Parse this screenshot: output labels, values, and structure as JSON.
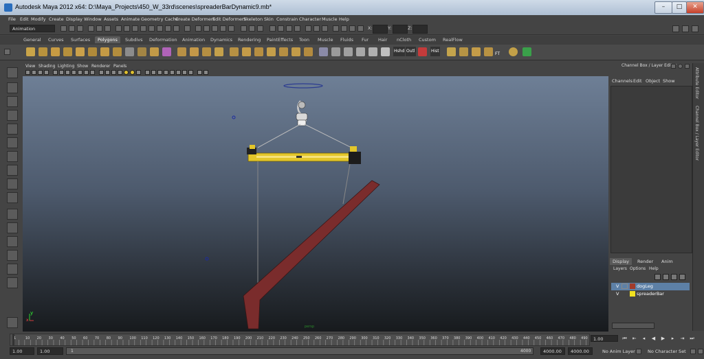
{
  "window": {
    "title": "Autodesk Maya 2012 x64: D:\\Maya_Projects\\450_W_33rd\\scenes\\spreaderBarDynamic9.mb*"
  },
  "menus": [
    "File",
    "Edit",
    "Modify",
    "Create",
    "Display",
    "Window",
    "Assets",
    "Animate",
    "Geometry Cache",
    "Create Deformers",
    "Edit Deformers",
    "Skeleton",
    "Skin",
    "Constrain",
    "Character",
    "Muscle",
    "Help"
  ],
  "status_line": {
    "mode": "Animation",
    "x_label": "X:",
    "y_label": "Y:",
    "z_label": "Z:"
  },
  "shelf_tabs": [
    "General",
    "Curves",
    "Surfaces",
    "Polygons",
    "Subdivs",
    "Deformation",
    "Animation",
    "Dynamics",
    "Rendering",
    "PaintEffects",
    "Toon",
    "Muscle",
    "Fluids",
    "Fur",
    "Hair",
    "nCloth",
    "Custom",
    "RealFlow"
  ],
  "shelf_active": "Polygons",
  "shelf_labels": [
    "Hshd",
    "Outl",
    "CP",
    "Hist",
    "FT"
  ],
  "panel_menu": [
    "View",
    "Shading",
    "Lighting",
    "Show",
    "Renderer",
    "Panels"
  ],
  "channel_box": {
    "title": "Channel Box / Layer Editor",
    "menu": [
      "Channels",
      "Edit",
      "Object",
      "Show"
    ]
  },
  "side_tabs": {
    "attribute_editor": "Attribute Editor",
    "channel_box": "Channel Box / Layer Editor"
  },
  "layer_editor": {
    "tabs": [
      "Display",
      "Render",
      "Anim"
    ],
    "active_tab": "Display",
    "menu": [
      "Layers",
      "Options",
      "Help"
    ],
    "layers": [
      {
        "visible": "V",
        "color": "#a23b2b",
        "name": "dogLeg",
        "selected": true
      },
      {
        "visible": "V",
        "color": "#f0e020",
        "name": "spreaderBar",
        "selected": false
      }
    ]
  },
  "viewport": {
    "axis_y": "y",
    "axis_x": "x",
    "camera": "persp"
  },
  "timeline": {
    "ticks": [
      "1",
      "5",
      "10",
      "15",
      "20",
      "25",
      "30",
      "35",
      "40",
      "45",
      "50",
      "55",
      "60",
      "65",
      "70",
      "75",
      "80",
      "85",
      "90",
      "95",
      "100",
      "105",
      "110",
      "115",
      "120",
      "125",
      "130",
      "135",
      "140",
      "145",
      "150",
      "155",
      "160",
      "165",
      "170",
      "175",
      "180",
      "185",
      "190",
      "195",
      "200",
      "205",
      "210",
      "215",
      "220",
      "225",
      "230",
      "235",
      "240",
      "245",
      "250",
      "255",
      "260",
      "265",
      "270",
      "275",
      "280",
      "285",
      "290",
      "295",
      "300",
      "305",
      "310",
      "315",
      "320",
      "325",
      "330",
      "335",
      "340",
      "345",
      "350",
      "355",
      "360",
      "365",
      "370",
      "375",
      "380",
      "385",
      "390",
      "395",
      "400",
      "405",
      "410",
      "415",
      "420",
      "425",
      "430",
      "435",
      "440",
      "445",
      "450",
      "455",
      "460",
      "465",
      "470",
      "475",
      "480",
      "485",
      "490",
      "495"
    ],
    "current_frame": "1.00"
  },
  "range": {
    "start_time": "1.00",
    "playback_start": "1.00",
    "playback_start_marker": "1",
    "range_end": "4000",
    "playback_end": "4000.00",
    "end_time": "4000.00",
    "anim_layer": "No Anim Layer",
    "character_set": "No Character Set"
  },
  "colors": {
    "accent": "#5d80a6",
    "beam": "#e3c62a",
    "dogleg": "#7a2c2c"
  }
}
